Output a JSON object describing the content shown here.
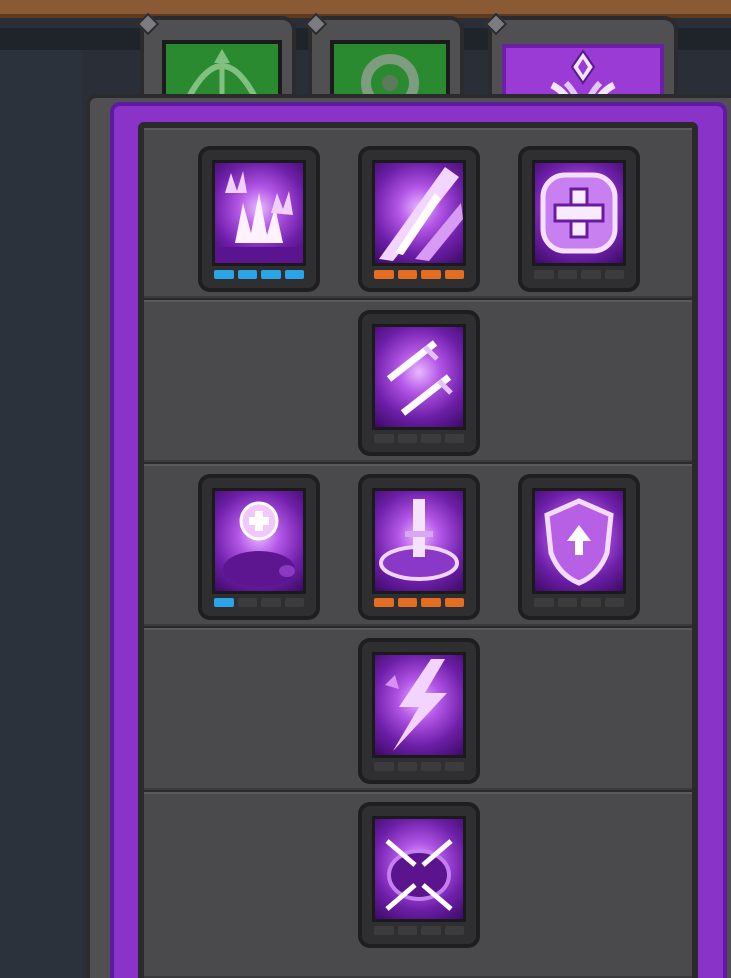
{
  "tabs": [
    {
      "id": "bow",
      "icon": "bow-icon",
      "color": "#2a8a30",
      "active": false
    },
    {
      "id": "ring",
      "icon": "ring-icon",
      "color": "#2a8a30",
      "active": false
    },
    {
      "id": "arcane",
      "icon": "crystal-crown-icon",
      "color": "#9b3bd6",
      "active": true
    }
  ],
  "colors": {
    "accent": "#9b3bd6",
    "pip_blue": "#2aa4e6",
    "pip_orange": "#e36d22",
    "pip_empty": "#3c3c3e"
  },
  "skill_tree": {
    "tiers": [
      {
        "skills": [
          {
            "icon": "purple-flames-icon",
            "filled": 4,
            "max": 4,
            "pip_color": "blue"
          },
          {
            "icon": "purple-slash-icon",
            "filled": 4,
            "max": 4,
            "pip_color": "orange"
          },
          {
            "icon": "heal-cross-icon",
            "filled": 0,
            "max": 4,
            "pip_color": "none"
          }
        ]
      },
      {
        "skills": [
          {
            "icon": "twin-swords-icon",
            "filled": 0,
            "max": 4,
            "pip_color": "none"
          }
        ]
      },
      {
        "skills": [
          {
            "icon": "healing-pet-icon",
            "filled": 1,
            "max": 4,
            "pip_color": "blue"
          },
          {
            "icon": "sword-altar-icon",
            "filled": 4,
            "max": 4,
            "pip_color": "orange"
          },
          {
            "icon": "shield-upgrade-icon",
            "filled": 0,
            "max": 4,
            "pip_color": "none"
          }
        ]
      },
      {
        "skills": [
          {
            "icon": "lightning-strike-icon",
            "filled": 0,
            "max": 4,
            "pip_color": "none"
          }
        ]
      },
      {
        "skills": [
          {
            "icon": "sword-circle-icon",
            "filled": 0,
            "max": 4,
            "pip_color": "none"
          }
        ]
      }
    ]
  }
}
